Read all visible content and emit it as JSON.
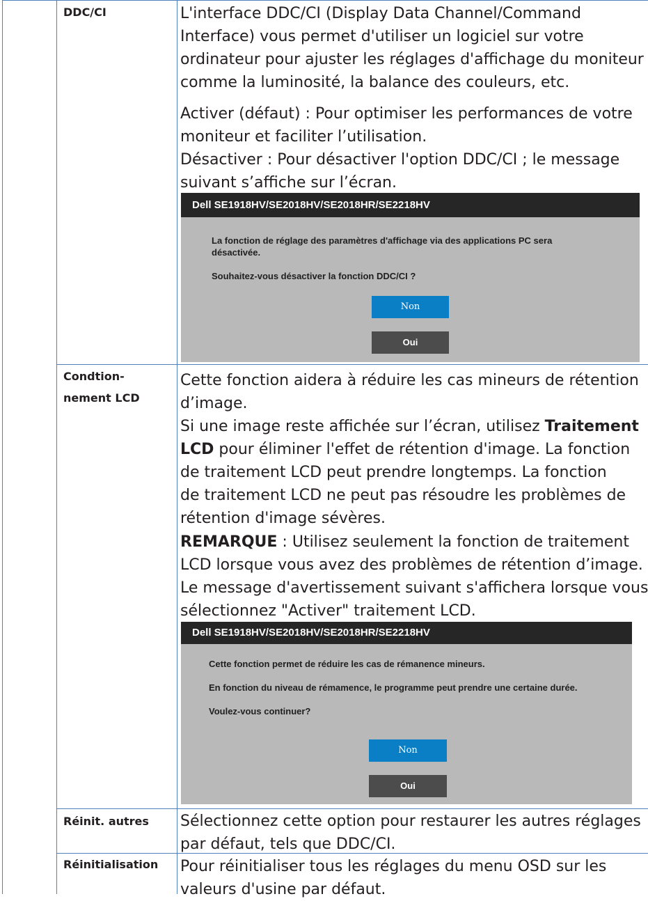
{
  "rows": [
    {
      "label": "DDC/CI"
    },
    {
      "label": "Condtion-\nnement LCD"
    },
    {
      "label": "Réinit. autres"
    },
    {
      "label": "Réinitialisation"
    }
  ],
  "ddc": {
    "p1": [
      "L'interface DDC/CI (Display Data Channel/Command",
      "Interface) vous permet d'utiliser un logiciel sur votre",
      "ordinateur pour ajuster les réglages d'affichage du moniteur",
      "comme la luminosité, la balance des couleurs, etc."
    ],
    "p2": [
      "Activer (défaut) : Pour optimiser les performances de votre",
      "moniteur et faciliter l’utilisation.",
      "Désactiver : Pour désactiver l'option DDC/CI ; le message",
      "suivant s’affiche sur l’écran."
    ]
  },
  "dialog1": {
    "title": "Dell SE1918HV/SE2018HV/SE2018HR/SE2218HV",
    "lines": [
      "La fonction de réglage des paramètres d'affichage via des applications PC sera",
      "désactivée.",
      "Souhaitez-vous désactiver la fonction DDC/CI ?"
    ],
    "primary": "Non",
    "secondary": "Oui"
  },
  "lcd": {
    "p1": [
      "Cette fonction aidera à réduire les cas mineurs de rétention",
      "d’image."
    ],
    "p2_line1": "Si une image reste affichée sur l’écran, utilisez ",
    "p2_bold1": "Traitement",
    "p2_bold2": "LCD",
    "p2_line2rest": " pour éliminer l'effet de rétention d'image. La fonction",
    "p2_rest": [
      "de traitement LCD peut prendre longtemps. La fonction",
      "de traitement LCD ne peut pas résoudre les problèmes de",
      "rétention d'image sévères."
    ],
    "note_bold": "REMARQUE",
    "note_line1": " : Utilisez seulement la fonction de traitement",
    "note_rest": [
      "LCD lorsque vous avez des problèmes de rétention d’image.",
      "Le message d'avertissement suivant s'affichera lorsque vous",
      "sélectionnez \"Activer\" traitement LCD."
    ]
  },
  "dialog2": {
    "title": "Dell SE1918HV/SE2018HV/SE2018HR/SE2218HV",
    "lines": [
      "Cette fonction permet de réduire les cas de rémanence mineurs.",
      "En fonction du niveau de rémamence, le programme peut prendre une certaine durée.",
      "Voulez-vous continuer?"
    ],
    "primary": "Non",
    "secondary": "Oui"
  },
  "reinit_autres": [
    "Sélectionnez cette option pour restaurer les autres réglages",
    "par défaut, tels que DDC/CI."
  ],
  "reinit": [
    "Pour réinitialiser tous les réglages du menu OSD sur les",
    "valeurs d'usine par défaut."
  ],
  "colors": {
    "rule": "#4f81bd",
    "dialog_bg": "#b9b9b9",
    "dialog_title_bg": "#262626",
    "primary_button": "#0a7fc6",
    "secondary_button": "#4c4c4c"
  }
}
